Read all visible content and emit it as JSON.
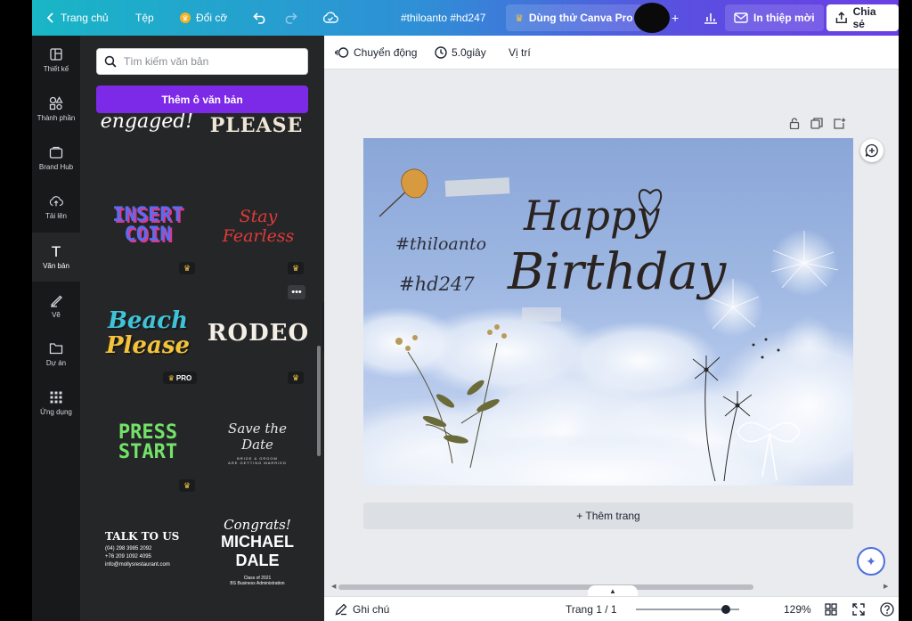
{
  "topbar": {
    "back_label": "Trang chủ",
    "file_label": "Tệp",
    "resize_label": "Đổi cỡ",
    "doc_title": "#thiloanto #hd247",
    "try_pro_label": "Dùng thử Canva Pro",
    "print_label": "In thiệp mời",
    "share_label": "Chia sẻ"
  },
  "rail": {
    "items": [
      {
        "label": "Thiết kế",
        "icon": "layout-icon"
      },
      {
        "label": "Thành phần",
        "icon": "elements-icon"
      },
      {
        "label": "Brand Hub",
        "icon": "brand-hub-icon"
      },
      {
        "label": "Tải lên",
        "icon": "upload-cloud-icon"
      },
      {
        "label": "Văn bản",
        "icon": "text-icon"
      },
      {
        "label": "Vẽ",
        "icon": "draw-icon"
      },
      {
        "label": "Dự án",
        "icon": "folder-icon"
      },
      {
        "label": "Ứng dụng",
        "icon": "apps-grid-icon"
      }
    ]
  },
  "panel": {
    "search_placeholder": "Tìm kiếm văn bản",
    "add_text_label": "Thêm ô văn bản",
    "templates": {
      "t1": "engaged!",
      "t2": "PLEASE",
      "t3_l1": "INSERT",
      "t3_l2": "COIN",
      "t4_l1": "Stay",
      "t4_l2": "Fearless",
      "t5_l1": "Beach",
      "t5_l2": "Please",
      "t6": "RODEO",
      "t7_l1": "PRESS",
      "t7_l2": "START",
      "t8_l1": "Save the Date",
      "t8_l2": "BRIDE & GROOM",
      "t8_l3": "ARE GETTING MARRIED",
      "t9_l1": "TALK TO US",
      "t9_l2": "(04) 298 3985 2092",
      "t9_l3": "+76 209 1092 4095",
      "t9_l4": "info@mollysrestaurant.com",
      "t10_l1": "Congrats!",
      "t10_l2": "MICHAEL",
      "t10_l3": "DALE",
      "t10_l4": "Class of 2021",
      "t10_l5": "BS Business Administration"
    },
    "pro_badge": "PRO",
    "more_label": "•••"
  },
  "context_bar": {
    "animate_label": "Chuyển động",
    "duration_label": "5.0giây",
    "position_label": "Vị trí"
  },
  "canvas": {
    "happy": "Happy",
    "birthday": "Birthday",
    "tag1": "#thiloanto",
    "tag2": "#hd247"
  },
  "editor": {
    "add_page_label": "+ Thêm trang"
  },
  "footer": {
    "notes_label": "Ghi chú",
    "page_indicator": "Trang 1 / 1",
    "zoom_label": "129%",
    "zoom_value": 0.87
  }
}
